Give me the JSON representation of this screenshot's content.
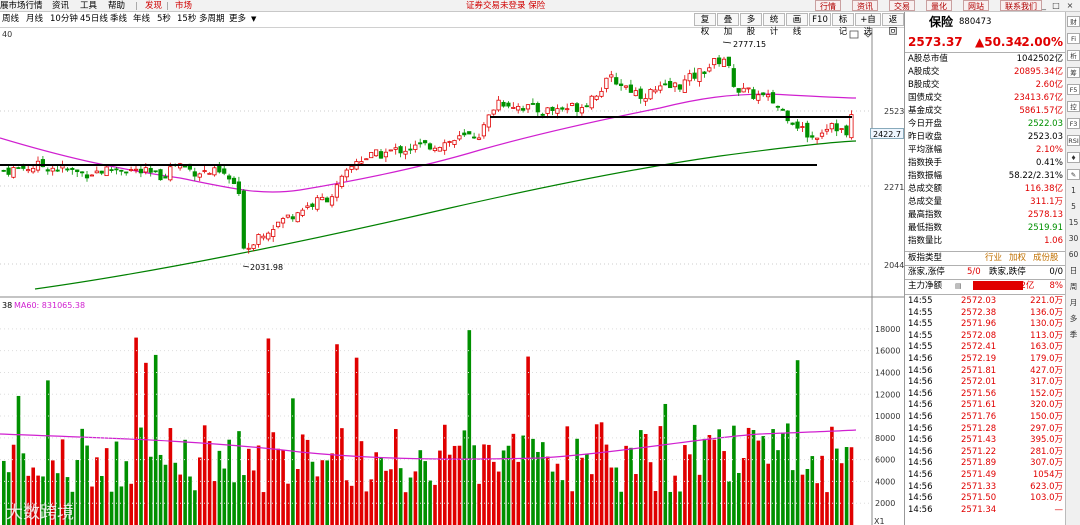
{
  "menubar": {
    "items": [
      "展市场行情",
      "资讯",
      "工具",
      "帮助"
    ],
    "highlight": [
      "发现",
      "市场"
    ],
    "center_text": "证券交易未登录 保险",
    "right_buttons": [
      "行情",
      "资讯",
      "交易",
      "量化",
      "网站",
      "联系我们"
    ]
  },
  "toolbar": {
    "periods": [
      "周线",
      "月线",
      "10分钟",
      "45日线",
      "季线",
      "年线",
      "5秒",
      "15秒",
      "多周期",
      "更多"
    ],
    "buttons": [
      "复权",
      "叠加",
      "多股",
      "统计",
      "画线",
      "F10",
      "标记",
      "+自选",
      "返回"
    ]
  },
  "chart": {
    "top_left_value": "40",
    "price_labels": [
      "2523",
      "2271",
      "2044"
    ],
    "max_annotation": "2777.15",
    "min_annotation": "2031.98",
    "current_price_tag": "2422.7",
    "volume_legend_prefix": "38",
    "volume_legend_ma": "MA60: 831065.38",
    "volume_labels": [
      "18000",
      "16000",
      "14000",
      "12000",
      "10000",
      "8000",
      "6000",
      "4000",
      "2000"
    ],
    "volume_unit": "X1"
  },
  "chart_data": {
    "type": "candlestick",
    "price_axis": {
      "ticks": [
        2523,
        2271,
        2044
      ]
    },
    "volume_axis": {
      "ticks": [
        18000,
        16000,
        14000,
        12000,
        10000,
        8000,
        6000,
        4000,
        2000
      ]
    },
    "ma60_volume": 831065.38,
    "max_price": 2777.15,
    "min_price": 2031.98,
    "last_price": 2573.37,
    "colors": {
      "up": "#e00000",
      "down": "#009000",
      "ma_pink": "#d020d0",
      "ma_green": "#008000"
    }
  },
  "quote": {
    "name": "保险",
    "code": "880473",
    "price": "2573.37",
    "change": "▲50.34",
    "change_pct": "2.00%"
  },
  "stats": [
    {
      "label": "A股总市值",
      "value": "1042502亿",
      "color": "black"
    },
    {
      "label": "A股成交",
      "value": "20895.34亿",
      "color": "red"
    },
    {
      "label": "B股成交",
      "value": "2.60亿",
      "color": "red"
    },
    {
      "label": "国债成交",
      "value": "23413.67亿",
      "color": "red"
    },
    {
      "label": "基金成交",
      "value": "5861.57亿",
      "color": "red"
    },
    {
      "label": "今日开盘",
      "value": "2522.03",
      "color": "green"
    },
    {
      "label": "昨日收盘",
      "value": "2523.03",
      "color": "black"
    },
    {
      "label": "平均涨幅",
      "value": "2.10%",
      "color": "red"
    },
    {
      "label": "指数换手",
      "value": "0.41%",
      "color": "black"
    },
    {
      "label": "指数振幅",
      "value": "58.22/2.31%",
      "color": "black"
    },
    {
      "label": "总成交额",
      "value": "116.38亿",
      "color": "red"
    },
    {
      "label": "总成交量",
      "value": "311.1万",
      "color": "red"
    },
    {
      "label": "最高指数",
      "value": "2578.13",
      "color": "red"
    },
    {
      "label": "最低指数",
      "value": "2519.91",
      "color": "green"
    },
    {
      "label": "指数量比",
      "value": "1.06",
      "color": "red"
    }
  ],
  "board": {
    "label": "板指类型",
    "links": [
      "行业",
      "加权",
      "成份股"
    ],
    "updown_label": "涨家,涨停",
    "updown_value": "5/0",
    "down_label": "跌家,跌停",
    "down_value": "0/0",
    "main_label": "主力净额",
    "main_value": "9.42亿",
    "main_pct": "8%"
  },
  "ticks": [
    {
      "time": "14:55",
      "price": "2572.03",
      "vol": "221.0万"
    },
    {
      "time": "14:55",
      "price": "2572.38",
      "vol": "136.0万"
    },
    {
      "time": "14:55",
      "price": "2571.96",
      "vol": "130.0万"
    },
    {
      "time": "14:55",
      "price": "2572.08",
      "vol": "113.0万"
    },
    {
      "time": "14:55",
      "price": "2572.41",
      "vol": "163.0万"
    },
    {
      "time": "14:56",
      "price": "2572.19",
      "vol": "179.0万"
    },
    {
      "time": "14:56",
      "price": "2571.81",
      "vol": "427.0万"
    },
    {
      "time": "14:56",
      "price": "2572.01",
      "vol": "317.0万"
    },
    {
      "time": "14:56",
      "price": "2571.56",
      "vol": "152.0万"
    },
    {
      "time": "14:56",
      "price": "2571.61",
      "vol": "320.0万"
    },
    {
      "time": "14:56",
      "price": "2571.76",
      "vol": "150.0万"
    },
    {
      "time": "14:56",
      "price": "2571.28",
      "vol": "297.0万"
    },
    {
      "time": "14:56",
      "price": "2571.43",
      "vol": "395.0万"
    },
    {
      "time": "14:56",
      "price": "2571.22",
      "vol": "281.0万"
    },
    {
      "time": "14:56",
      "price": "2571.89",
      "vol": "307.0万"
    },
    {
      "time": "14:56",
      "price": "2571.49",
      "vol": "1054万"
    },
    {
      "time": "14:56",
      "price": "2571.33",
      "vol": "623.0万"
    },
    {
      "time": "14:56",
      "price": "2571.50",
      "vol": "103.0万"
    },
    {
      "time": "14:56",
      "price": "2571.34",
      "vol": "—"
    }
  ],
  "sidetabs": [
    "财",
    "Fi",
    "析",
    "筹",
    "F5",
    "控",
    "F3",
    "RSI",
    "♦",
    "✎",
    "1",
    "5",
    "15",
    "30",
    "60",
    "日",
    "周",
    "月",
    "多",
    "季"
  ],
  "watermark": "大数跨境"
}
